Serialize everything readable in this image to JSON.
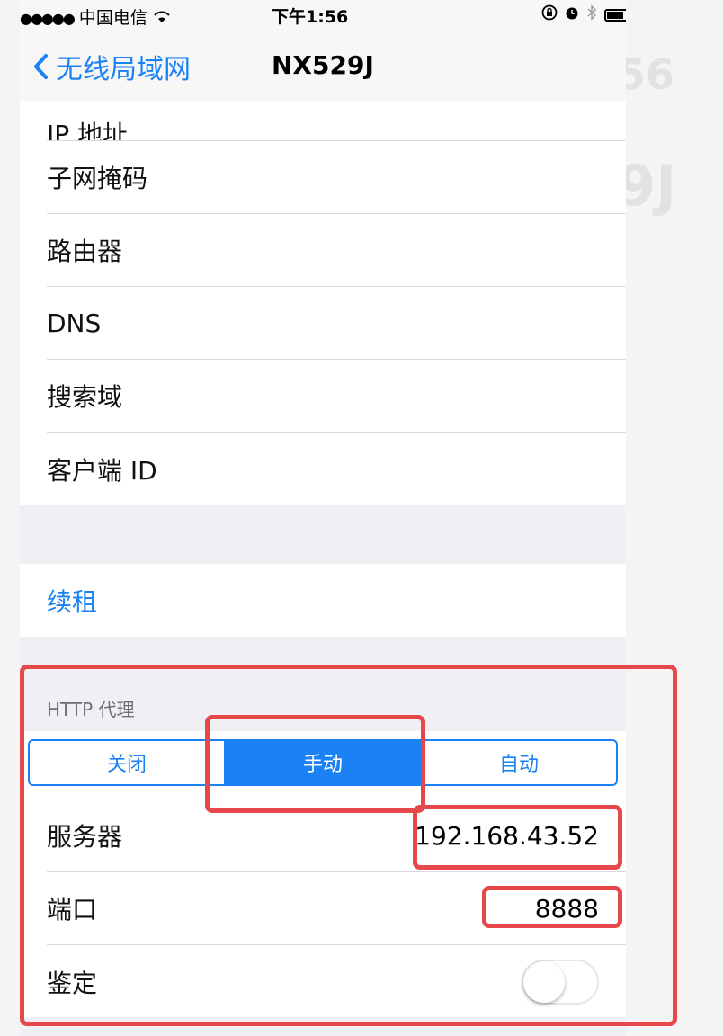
{
  "status_bar": {
    "signal": "●●●●●",
    "carrier": "中国电信",
    "time": "下午1:56"
  },
  "nav": {
    "back_label": "无线局域网",
    "title": "NX529J"
  },
  "ghost": {
    "time_fragment": "56",
    "title_fragment": "9J"
  },
  "ip_section": {
    "rows": [
      {
        "label": "IP 地址"
      },
      {
        "label": "子网掩码"
      },
      {
        "label": "路由器"
      },
      {
        "label": "DNS"
      },
      {
        "label": "搜索域"
      },
      {
        "label": "客户端 ID"
      }
    ]
  },
  "renew": {
    "label": "续租"
  },
  "proxy": {
    "section_label": "HTTP 代理",
    "modes": [
      "关闭",
      "手动",
      "自动"
    ],
    "selected_mode": "手动",
    "server_label": "服务器",
    "server_value": "192.168.43.52",
    "port_label": "端口",
    "port_value": "8888",
    "auth_label": "鉴定",
    "auth_enabled": false
  },
  "colors": {
    "accent": "#1b82f5",
    "highlight": "#e5474a"
  }
}
